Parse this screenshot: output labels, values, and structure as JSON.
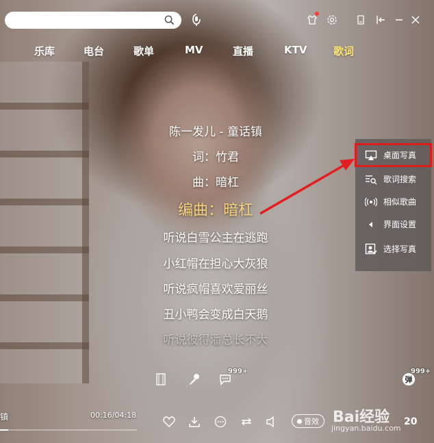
{
  "search": {
    "value": "",
    "placeholder": ""
  },
  "nav": {
    "items": [
      "乐库",
      "电台",
      "歌单",
      "MV",
      "直播",
      "KTV",
      "歌词"
    ],
    "active": "歌词"
  },
  "lyrics": {
    "lines": [
      "陈一发儿 - 童话镇",
      "词：竹君",
      "曲：暗杠",
      "编曲：暗杠",
      "听说白雪公主在逃跑",
      "小红帽在担心大灰狼",
      "听说疯帽喜欢爱丽丝",
      "丑小鸭会变成白天鹅",
      "听说彼得潘总长不大"
    ],
    "current_index": 3
  },
  "side_menu": {
    "items": [
      {
        "label": "桌面写真",
        "icon": "screen-icon",
        "highlighted": true
      },
      {
        "label": "歌词搜索",
        "icon": "lyric-search-icon",
        "highlighted": false
      },
      {
        "label": "相似歌曲",
        "icon": "broadcast-icon",
        "highlighted": false
      },
      {
        "label": "界面设置",
        "icon": "triangle-left-icon",
        "highlighted": false
      },
      {
        "label": "选择写真",
        "icon": "portrait-icon",
        "highlighted": false
      }
    ]
  },
  "badges": {
    "comment_count": "999+",
    "danmaku_count": "999+",
    "danmaku_label": "弹"
  },
  "player": {
    "song_tail": "镇",
    "time": "00:16/04:18",
    "progress_fraction": 0.062,
    "effect_label": "音效",
    "right_number": "20"
  },
  "watermark": {
    "main": "Bai经验",
    "sub": "jingyan.baidu.com"
  },
  "colors": {
    "accent_yellow": "#ffe873",
    "current_lyric": "#f7d27a",
    "highlight_red": "#e01b1b",
    "badge_red": "#ff3b30"
  }
}
